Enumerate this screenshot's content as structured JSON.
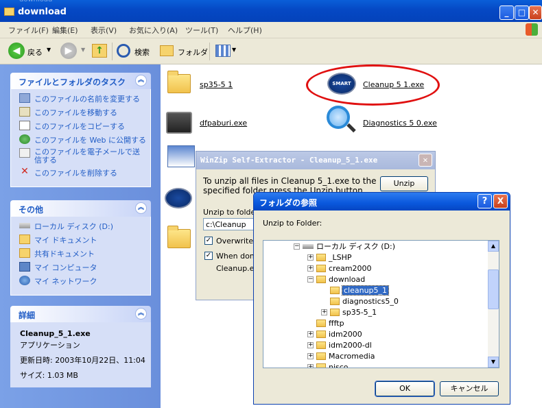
{
  "window": {
    "title": "download",
    "ghost_title": "download"
  },
  "menu": [
    "ファイル(F)",
    "編集(E)",
    "表示(V)",
    "お気に入り(A)",
    "ツール(T)",
    "ヘルプ(H)"
  ],
  "toolbar": {
    "back_label": "戻る",
    "search_label": "検索",
    "folders_label": "フォルダ"
  },
  "tasks": {
    "title": "ファイルとフォルダのタスク",
    "items": [
      "このファイルの名前を変更する",
      "このファイルを移動する",
      "このファイルをコピーする",
      "このファイルを Web に公開する",
      "このファイルを電子メールで送信する",
      "このファイルを削除する"
    ]
  },
  "others": {
    "title": "その他",
    "items": [
      "ローカル ディスク (D:)",
      "マイ ドキュメント",
      "共有ドキュメント",
      "マイ コンピュータ",
      "マイ ネットワーク"
    ]
  },
  "details": {
    "title": "詳細",
    "filename": "Cleanup_5_1.exe",
    "type": "アプリケーション",
    "modified": "更新日時: 2003年10月22日、11:04",
    "size": "サイズ: 1.03 MB"
  },
  "files": [
    {
      "name": "sp35-5 1"
    },
    {
      "name": "Cleanup 5 1.exe",
      "icon_text": "SMART DRIVER"
    },
    {
      "name": "dfpaburi.exe"
    },
    {
      "name": "Diagnostics 5 0.exe"
    }
  ],
  "winzip": {
    "title": "WinZip Self-Extractor - Cleanup_5_1.exe",
    "message": "To unzip all files in Cleanup 5_1.exe to the specified folder press the Unzip button.",
    "unzip_button": "Unzip",
    "folder_label": "Unzip to folder:",
    "folder_value": "c:\\Cleanup",
    "overwrite_label": "Overwrite fi",
    "when_done_label": "When done",
    "cleanup_text": "Cleanup.exe"
  },
  "browse": {
    "title": "フォルダの参照",
    "label": "Unzip to Folder:",
    "tree": [
      {
        "label": "ローカル ディスク (D:)",
        "pm": "−"
      },
      {
        "label": "_LSHP",
        "pm": "+"
      },
      {
        "label": "cream2000",
        "pm": "+"
      },
      {
        "label": "download",
        "pm": "−"
      },
      {
        "label": "cleanup5_1",
        "pm": "",
        "selected": true
      },
      {
        "label": "diagnostics5_0",
        "pm": ""
      },
      {
        "label": "sp35-5_1",
        "pm": "+"
      },
      {
        "label": "ffftp",
        "pm": ""
      },
      {
        "label": "idm2000",
        "pm": "+"
      },
      {
        "label": "idm2000-dl",
        "pm": "+"
      },
      {
        "label": "Macromedia",
        "pm": "+"
      },
      {
        "label": "nisco",
        "pm": "+"
      }
    ],
    "ok": "OK",
    "cancel": "キャンセル",
    "help": "?",
    "close": "X"
  },
  "colors": {
    "accent": "#215dc6",
    "titlebar": "#0548c4",
    "highlight": "#e01010",
    "selection": "#316ac5"
  }
}
